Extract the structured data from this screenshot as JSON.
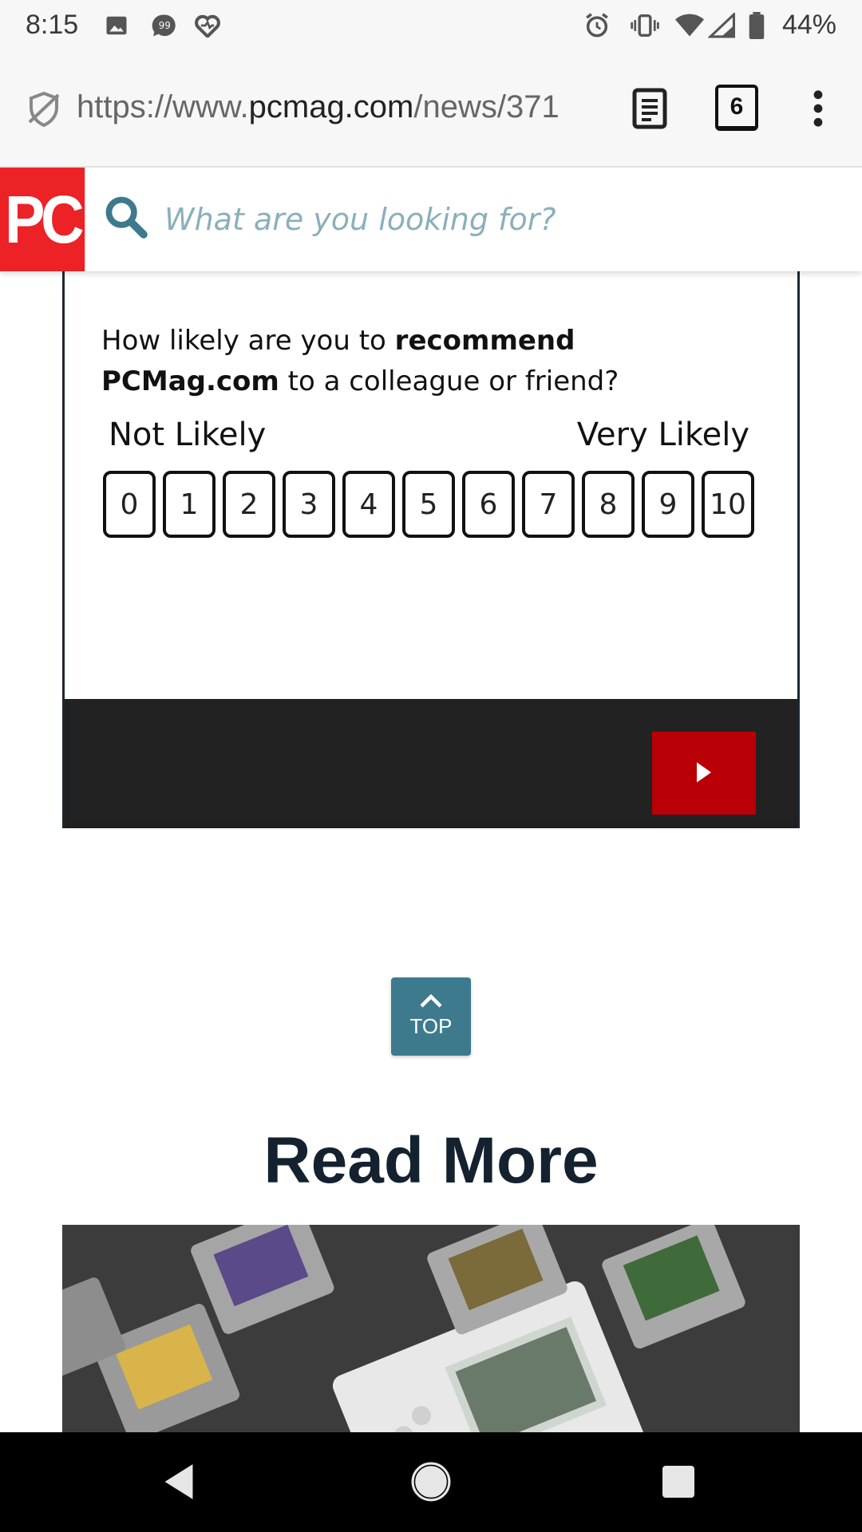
{
  "status_bar": {
    "time": "8:15",
    "battery": "44%",
    "icons": [
      "image-icon",
      "chat-icon",
      "heart-pulse-icon",
      "alarm-icon",
      "vibrate-icon",
      "wifi-icon",
      "signal-icon",
      "battery-icon"
    ]
  },
  "browser": {
    "url_prefix": "https://www.",
    "url_host": "pcmag.com",
    "url_path": "/news/371",
    "tab_count": "6"
  },
  "site": {
    "logo": "PC",
    "search_placeholder": "What are you looking for?",
    "brand_color": "#ec2227"
  },
  "survey": {
    "question_prefix": "How likely are you to ",
    "question_bold1": "recommend",
    "question_bold2": "PCMag.com",
    "question_suffix": " to a colleague or friend?",
    "low_label": "Not Likely",
    "high_label": "Very Likely",
    "scale": [
      "0",
      "1",
      "2",
      "3",
      "4",
      "5",
      "6",
      "7",
      "8",
      "9",
      "10"
    ],
    "next_color": "#b80006"
  },
  "top_button": {
    "label": "TOP"
  },
  "read_more": {
    "heading": "Read More"
  },
  "nav": {
    "icons": [
      "back-icon",
      "home-icon",
      "recents-icon"
    ]
  }
}
